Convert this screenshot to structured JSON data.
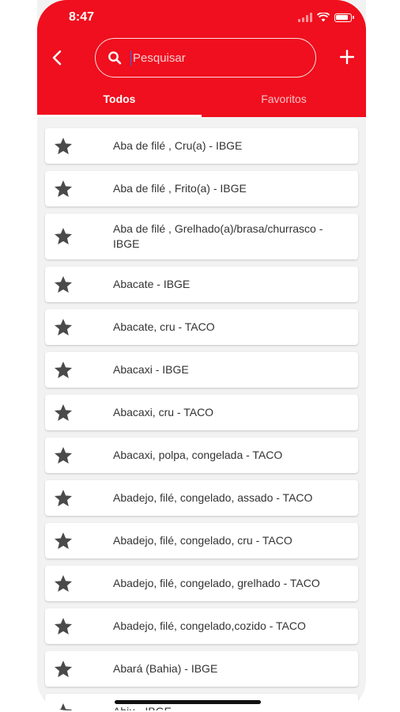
{
  "status": {
    "time": "8:47"
  },
  "search": {
    "placeholder": "Pesquisar",
    "value": ""
  },
  "tabs": [
    {
      "label": "Todos",
      "active": true
    },
    {
      "label": "Favoritos",
      "active": false
    }
  ],
  "items": [
    "Aba de filé , Cru(a) - IBGE",
    "Aba de filé , Frito(a) - IBGE",
    "Aba de filé , Grelhado(a)/brasa/churrasco - IBGE",
    "Abacate - IBGE",
    "Abacate, cru - TACO",
    "Abacaxi - IBGE",
    "Abacaxi, cru - TACO",
    "Abacaxi, polpa, congelada - TACO",
    "Abadejo, filé, congelado, assado - TACO",
    "Abadejo, filé, congelado, cru - TACO",
    "Abadejo, filé, congelado, grelhado - TACO",
    "Abadejo, filé, congelado,cozido - TACO",
    "Abará (Bahia) - IBGE",
    "Abiu - IBGE"
  ],
  "colors": {
    "accent": "#ef0f1e",
    "star": "#4a4a4a"
  },
  "icons": {
    "back": "chevron-left-icon",
    "search": "search-icon",
    "add": "plus-icon",
    "star": "star-icon"
  }
}
